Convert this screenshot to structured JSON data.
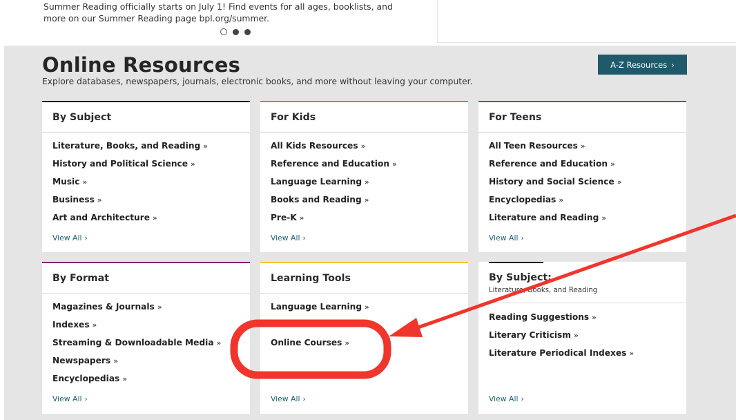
{
  "promo": {
    "text": "Summer Reading officially starts on July 1! Find events for all ages, booklists, and more on our Summer Reading page bpl.org/summer."
  },
  "section": {
    "title": "Online Resources",
    "subtitle": "Explore databases, newspapers, journals, electronic books, and more without leaving your computer.",
    "az_button": "A-Z Resources",
    "az_icon": "›"
  },
  "cards": [
    {
      "title": "By Subject",
      "accent": "#000000",
      "items": [
        "Literature, Books, and Reading",
        "History and Political Science",
        "Music",
        "Business",
        "Art and Architecture"
      ],
      "view_all": "View All"
    },
    {
      "title": "For Kids",
      "accent": "#e8702a",
      "items": [
        "All Kids Resources",
        "Reference and Education",
        "Language Learning",
        "Books and Reading",
        "Pre-K"
      ],
      "view_all": "View All"
    },
    {
      "title": "For Teens",
      "accent": "#3f7a2c",
      "items": [
        "All Teen Resources",
        "Reference and Education",
        "History and Social Science",
        "Encyclopedias",
        "Literature and Reading"
      ],
      "view_all": "View All"
    },
    {
      "title": "By Format",
      "accent": "#8a1f6a",
      "items": [
        "Magazines & Journals",
        "Indexes",
        "Streaming & Downloadable Media",
        "Newspapers",
        "Encyclopedias"
      ],
      "view_all": "View All"
    },
    {
      "title": "Learning Tools",
      "accent": "#f2c233",
      "items": [
        "Language Learning",
        "Online Courses"
      ],
      "view_all": "View All"
    },
    {
      "title": "By Subject:",
      "subline": "Literature, Books, and Reading",
      "accent": "#000000",
      "items": [
        "Reading Suggestions",
        "Literary Criticism",
        "Literature Periodical Indexes"
      ],
      "view_all": "View All"
    }
  ],
  "raquo": "»",
  "chevron": "›",
  "annotation_color": "#f0352c"
}
